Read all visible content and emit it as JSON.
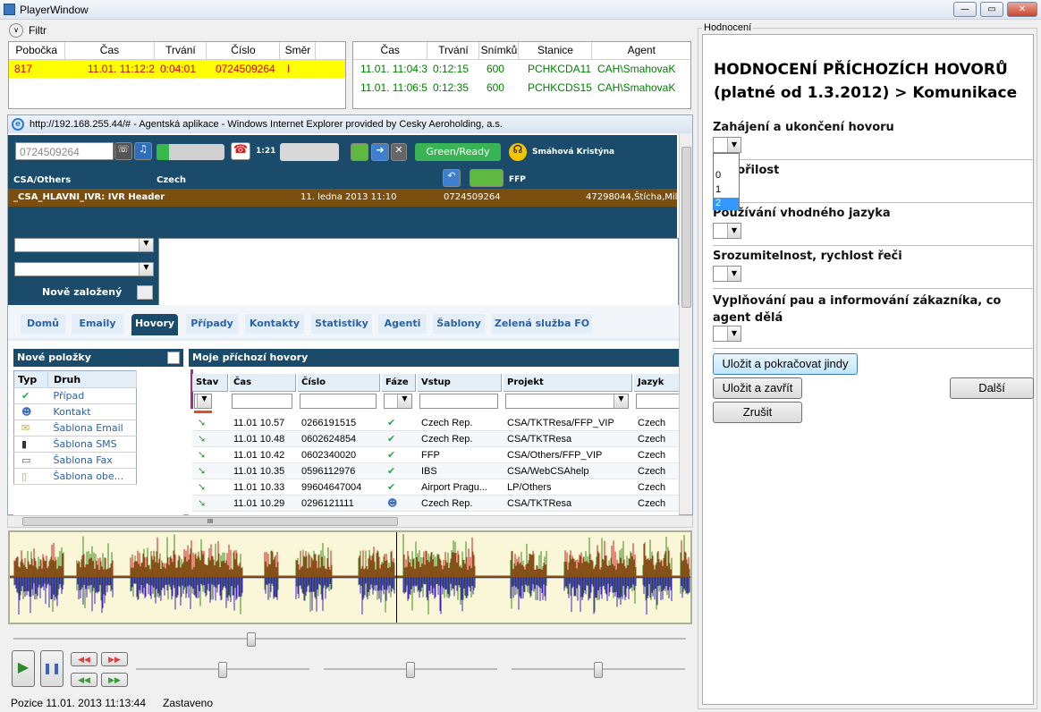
{
  "window": {
    "title": "PlayerWindow"
  },
  "filter": {
    "label": "Filtr"
  },
  "calls_left": {
    "columns": [
      "Pobočka",
      "Čas",
      "Trvání",
      "Číslo",
      "Směr"
    ],
    "rows": [
      [
        "817",
        "11.01. 11:12:2",
        "0:04:01",
        "0724509264",
        "I"
      ]
    ]
  },
  "calls_right": {
    "columns": [
      "Čas",
      "Trvání",
      "Snímků",
      "Stanice",
      "Agent"
    ],
    "rows": [
      [
        "11.01. 11:04:3",
        "0:12:15",
        "600",
        "PCHKCDA11",
        "CAH\\SmahovaK"
      ],
      [
        "11.01. 11:06:5",
        "0:12:35",
        "600",
        "PCHKCDS15",
        "CAH\\SmahovaK"
      ]
    ]
  },
  "browser": {
    "title": "http://192.168.255.44/# - Agentská aplikace - Windows Internet Explorer provided by Cesky Aeroholding, a.s."
  },
  "app": {
    "phone_input": "0724509264",
    "timer": "1:21",
    "status_label": "Green/Ready",
    "agent_name": "Smáhová Kristýna",
    "queue": "CSA/Others",
    "language": "Czech",
    "ffp": "FFP",
    "ivr": {
      "name": "_CSA_HLAVNI_IVR: IVR Header",
      "date": "11. ledna 2013 11:10",
      "number": "0724509264",
      "extra": "47298044,Štícha,Mil"
    },
    "new_created_label": "Nově založený",
    "tabs": [
      "Domů",
      "Emaily",
      "Hovory",
      "Případy",
      "Kontakty",
      "Statistiky",
      "Agenti",
      "Šablony",
      "Zelená služba FO"
    ],
    "active_tab": "Hovory",
    "new_items": {
      "title": "Nové položky",
      "columns": [
        "Typ",
        "Druh"
      ],
      "items": [
        {
          "icon": "check-icon",
          "label": "Případ"
        },
        {
          "icon": "person-icon",
          "label": "Kontakt"
        },
        {
          "icon": "email-icon",
          "label": "Šablona Email"
        },
        {
          "icon": "phone-icon",
          "label": "Šablona SMS"
        },
        {
          "icon": "fax-icon",
          "label": "Šablona Fax"
        },
        {
          "icon": "doc-icon",
          "label": "Šablona obe..."
        }
      ]
    },
    "incoming": {
      "title": "Moje příchozí hovory",
      "columns": [
        "Stav",
        "Čas",
        "Číslo",
        "Fáze",
        "Vstup",
        "Projekt",
        "Jazyk"
      ],
      "rows": [
        [
          "11.01 10.57",
          "0266191515",
          "check",
          "Czech Rep.",
          "CSA/TKTResa/FFP_VIP",
          "Czech"
        ],
        [
          "11.01 10.48",
          "0602624854",
          "check",
          "Czech Rep.",
          "CSA/TKTResa",
          "Czech"
        ],
        [
          "11.01 10.42",
          "0602340020",
          "check",
          "FFP",
          "CSA/Others/FFP_VIP",
          "Czech"
        ],
        [
          "11.01 10.35",
          "0596112976",
          "check",
          "IBS",
          "CSA/WebCSAhelp",
          "Czech"
        ],
        [
          "11.01 10.33",
          "99604647004",
          "check",
          "Airport Pragu...",
          "LP/Others",
          "Czech"
        ],
        [
          "11.01 10.29",
          "0296121111",
          "person",
          "Czech Rep.",
          "CSA/TKTResa",
          "Czech"
        ]
      ]
    }
  },
  "status": {
    "position": "Pozice 11.01. 2013 11:13:44",
    "state": "Zastaveno"
  },
  "evaluation": {
    "group_label": "Hodnocení",
    "title_line1": "HODNOCENÍ PŘÍCHOZÍCH HOVORŮ",
    "title_line2": "(platné od 1.3.2012) > Komunikace",
    "questions": [
      "Zahájení a ukončení hovoru",
      "Zdvořilost",
      "Používání vhodného jazyka",
      "Srozumitelnost, rychlost řeči",
      "Vyplňování pau a informování zákazníka, co agent dělá"
    ],
    "dropdown_options": [
      "0",
      "1",
      "2"
    ],
    "selected_option": "2",
    "buttons": {
      "save_continue": "Uložit a pokračovat jindy",
      "save_close": "Uložit a zavřít",
      "next": "Další",
      "cancel": "Zrušit"
    }
  },
  "colors": {
    "highlight_row": "#ffff00",
    "dark_header": "#1a4b6a",
    "ivr_bar": "#7a4e0e",
    "green_text": "#008000",
    "red_text": "#e00000",
    "wave_bg": "#faf7d8"
  }
}
